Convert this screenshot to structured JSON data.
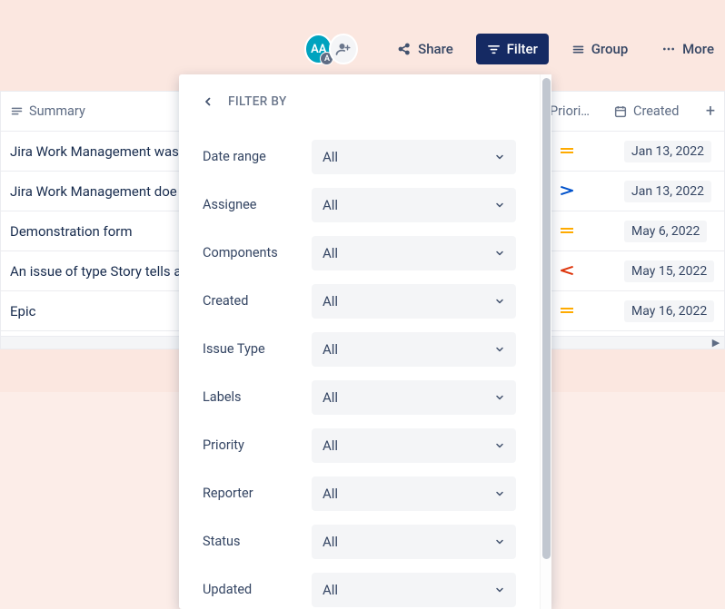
{
  "toolbar": {
    "avatar_initials": "AA",
    "avatar_sub": "A",
    "share_label": "Share",
    "filter_label": "Filter",
    "group_label": "Group",
    "more_label": "More"
  },
  "columns": {
    "summary": "Summary",
    "priority": "Priori…",
    "created": "Created"
  },
  "rows": [
    {
      "summary": "Jira Work Management was",
      "priority": "medium",
      "created": "Jan 13, 2022"
    },
    {
      "summary": "Jira Work Management doe",
      "priority": "low",
      "created": "Jan 13, 2022"
    },
    {
      "summary": "Demonstration form",
      "priority": "medium",
      "created": "May 6, 2022"
    },
    {
      "summary": "An issue of type Story tells a",
      "priority": "high",
      "created": "May 15, 2022"
    },
    {
      "summary": "Epic",
      "priority": "medium",
      "created": "May 16, 2022"
    }
  ],
  "filter_panel": {
    "title": "FILTER BY",
    "default_value": "All",
    "fields": [
      "Date range",
      "Assignee",
      "Components",
      "Created",
      "Issue Type",
      "Labels",
      "Priority",
      "Reporter",
      "Status",
      "Updated"
    ]
  }
}
